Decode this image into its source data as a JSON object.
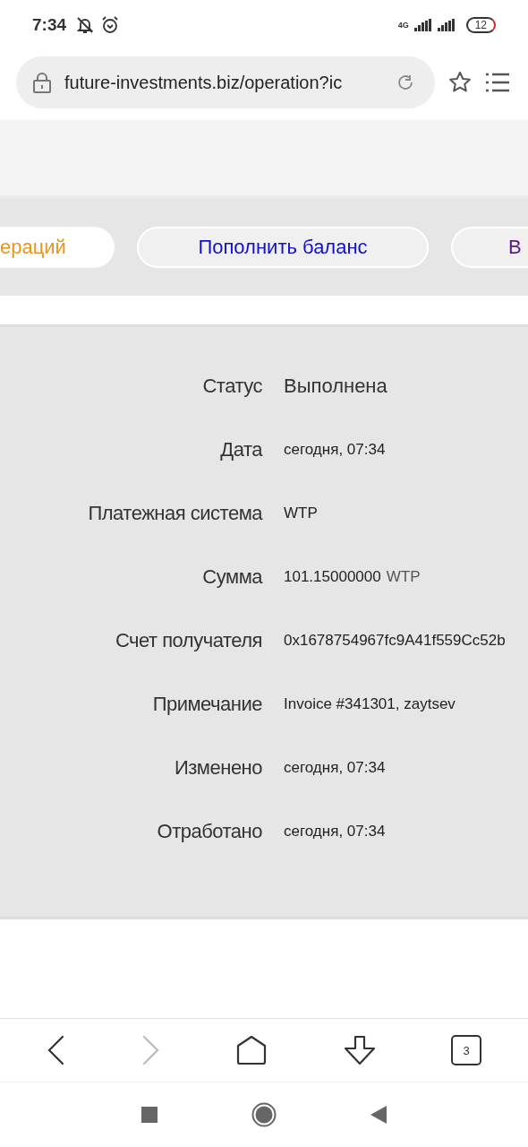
{
  "status_bar": {
    "time": "7:34",
    "network": "4G",
    "battery": "12"
  },
  "address_bar": {
    "url": "future-investments.biz/operation?ic"
  },
  "tabs": [
    {
      "label": "ераций",
      "selected": true,
      "color": "#e8961a"
    },
    {
      "label": "Пополнить баланс",
      "selected": false,
      "color": "#1010c8"
    },
    {
      "label": "В",
      "selected": false,
      "color": "#5a1a8c"
    }
  ],
  "details": [
    {
      "label": "Статус",
      "value": "Выполнена",
      "kind": "status"
    },
    {
      "label": "Дата",
      "value": "сегодня, 07:34",
      "kind": "text"
    },
    {
      "label": "Платежная система",
      "value": "WTP",
      "kind": "text"
    },
    {
      "label": "Сумма",
      "value": "101.15000000",
      "unit": "WTP",
      "kind": "amount"
    },
    {
      "label": "Счет получателя",
      "value": "0x1678754967fc9A41f559Cc52b",
      "kind": "text"
    },
    {
      "label": "Примечание",
      "value": "Invoice #341301, zaytsev",
      "kind": "text"
    },
    {
      "label": "Изменено",
      "value": "сегодня, 07:34",
      "kind": "text"
    },
    {
      "label": "Отработано",
      "value": "сегодня, 07:34",
      "kind": "text"
    }
  ],
  "browser_toolbar": {
    "tab_count": "3",
    "forward_disabled": true
  }
}
